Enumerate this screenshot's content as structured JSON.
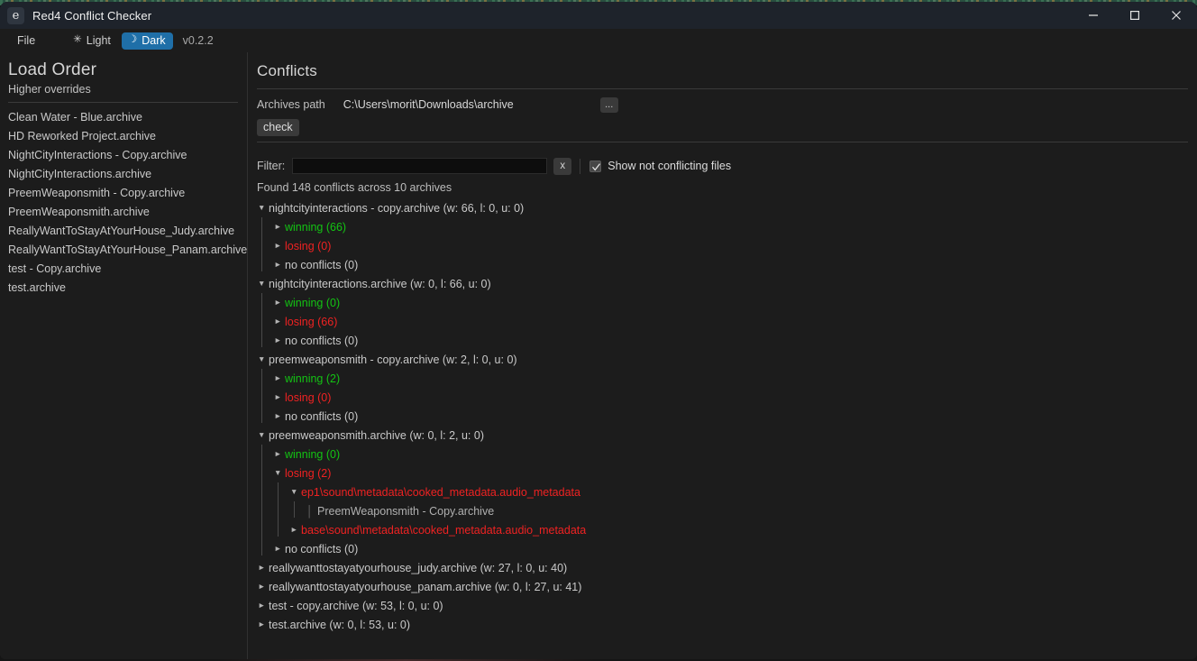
{
  "window": {
    "title": "Red4 Conflict Checker",
    "app_icon": "edge-app-icon",
    "icon_letter": "e",
    "controls": {
      "minimize": "minimize-icon",
      "maximize": "maximize-icon",
      "close": "close-icon"
    }
  },
  "menubar": {
    "file": "File",
    "light": "Light",
    "light_icon": "sun-icon",
    "light_glyph": "✳",
    "dark": "Dark",
    "dark_icon": "moon-icon",
    "dark_glyph": "☽",
    "active_theme": "Dark",
    "version": "v0.2.2",
    "accent": "#1f6fa8"
  },
  "sidebar": {
    "title": "Load Order",
    "subtitle": "Higher overrides",
    "items": [
      {
        "label": "Clean Water - Blue.archive"
      },
      {
        "label": "HD Reworked Project.archive"
      },
      {
        "label": "NightCityInteractions - Copy.archive"
      },
      {
        "label": "NightCityInteractions.archive"
      },
      {
        "label": "PreemWeaponsmith - Copy.archive"
      },
      {
        "label": "PreemWeaponsmith.archive"
      },
      {
        "label": "ReallyWantToStayAtYourHouse_Judy.archive"
      },
      {
        "label": "ReallyWantToStayAtYourHouse_Panam.archive"
      },
      {
        "label": "test - Copy.archive"
      },
      {
        "label": "test.archive"
      }
    ]
  },
  "main": {
    "title": "Conflicts",
    "path_label": "Archives path",
    "path_value": "C:\\Users\\morit\\Downloads\\archive",
    "browse_label": "...",
    "check_label": "check",
    "filter_label": "Filter:",
    "filter_value": "",
    "filter_placeholder": "",
    "clear_label": "x",
    "show_not_conflicting_label": "Show not conflicting files",
    "show_not_conflicting_checked": true,
    "found_text": "Found 148 conflicts across 10 archives"
  },
  "colors": {
    "winning": "#13c413",
    "losing": "#ef2222",
    "neutral": "#c9c9c9",
    "titlebar": "#1e232b",
    "background": "#1c1c1c"
  },
  "tree": [
    {
      "label": "nightcityinteractions - copy.archive (w: 66, l: 0, u: 0)",
      "state": "expanded",
      "tone": "neutral",
      "children": [
        {
          "label": "winning (66)",
          "state": "collapsed",
          "tone": "win"
        },
        {
          "label": "losing (0)",
          "state": "collapsed",
          "tone": "lose"
        },
        {
          "label": "no conflicts (0)",
          "state": "collapsed",
          "tone": "neutral"
        }
      ]
    },
    {
      "label": "nightcityinteractions.archive (w: 0, l: 66, u: 0)",
      "state": "expanded",
      "tone": "neutral",
      "children": [
        {
          "label": "winning (0)",
          "state": "collapsed",
          "tone": "win"
        },
        {
          "label": "losing (66)",
          "state": "collapsed",
          "tone": "lose"
        },
        {
          "label": "no conflicts (0)",
          "state": "collapsed",
          "tone": "neutral"
        }
      ]
    },
    {
      "label": "preemweaponsmith - copy.archive (w: 2, l: 0, u: 0)",
      "state": "expanded",
      "tone": "neutral",
      "children": [
        {
          "label": "winning (2)",
          "state": "collapsed",
          "tone": "win"
        },
        {
          "label": "losing (0)",
          "state": "collapsed",
          "tone": "lose"
        },
        {
          "label": "no conflicts (0)",
          "state": "collapsed",
          "tone": "neutral"
        }
      ]
    },
    {
      "label": "preemweaponsmith.archive (w: 0, l: 2, u: 0)",
      "state": "expanded",
      "tone": "neutral",
      "children": [
        {
          "label": "winning (0)",
          "state": "collapsed",
          "tone": "win"
        },
        {
          "label": "losing (2)",
          "state": "expanded",
          "tone": "lose",
          "children": [
            {
              "label": "ep1\\sound\\metadata\\cooked_metadata.audio_metadata",
              "state": "expanded",
              "tone": "lose",
              "children": [
                {
                  "label": "PreemWeaponsmith - Copy.archive",
                  "state": "leaf",
                  "tone": "muted"
                }
              ]
            },
            {
              "label": "base\\sound\\metadata\\cooked_metadata.audio_metadata",
              "state": "collapsed",
              "tone": "lose"
            }
          ]
        },
        {
          "label": "no conflicts (0)",
          "state": "collapsed",
          "tone": "neutral"
        }
      ]
    },
    {
      "label": "reallywanttostayatyourhouse_judy.archive (w: 27, l: 0, u: 40)",
      "state": "collapsed",
      "tone": "neutral"
    },
    {
      "label": "reallywanttostayatyourhouse_panam.archive (w: 0, l: 27, u: 41)",
      "state": "collapsed",
      "tone": "neutral"
    },
    {
      "label": "test - copy.archive (w: 53, l: 0, u: 0)",
      "state": "collapsed",
      "tone": "neutral"
    },
    {
      "label": "test.archive (w: 0, l: 53, u: 0)",
      "state": "collapsed",
      "tone": "neutral"
    }
  ]
}
